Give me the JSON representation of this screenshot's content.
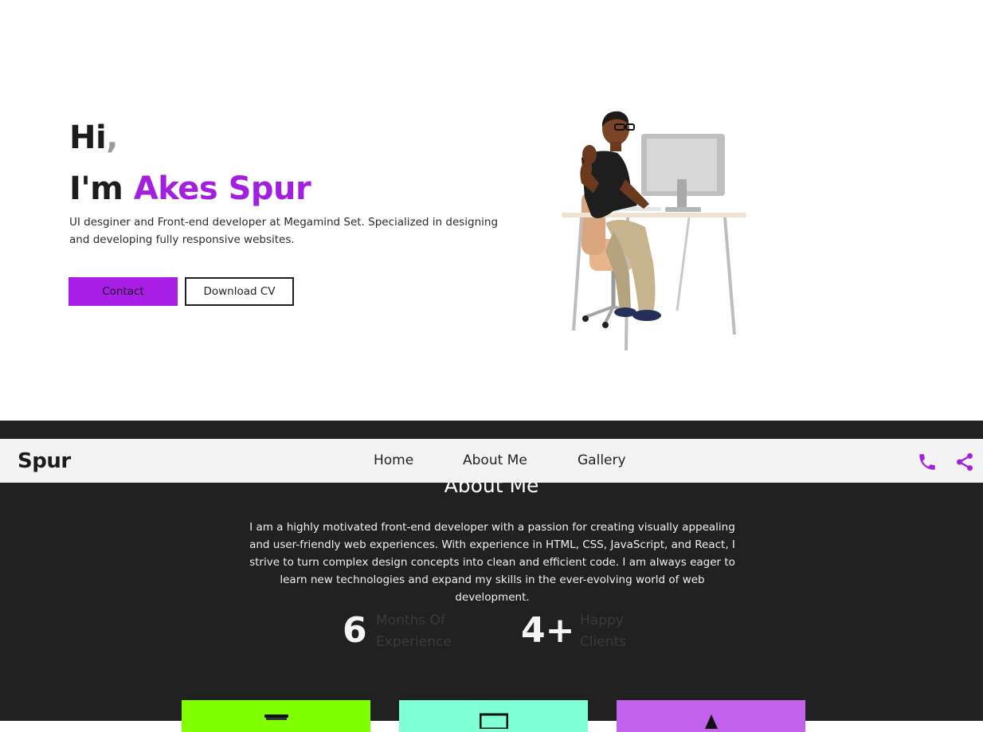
{
  "hero": {
    "greeting": "Hi",
    "greeting_punct": ",",
    "intro_prefix": "I'm ",
    "name": "Akes Spur",
    "bio": "UI desginer and Front-end developer at Megamind Set. Specialized in designing and developing fully responsive websites.",
    "contact_label": "Contact",
    "download_label": "Download CV",
    "illustration": "person-at-desk-illustration"
  },
  "navbar": {
    "brand": "Spur",
    "items": [
      {
        "label": "Home"
      },
      {
        "label": "About Me"
      },
      {
        "label": "Gallery"
      }
    ],
    "icons": [
      "phone-icon",
      "share-icon"
    ]
  },
  "about": {
    "title": "About Me",
    "text": "I am a highly motivated front-end developer with a passion for creating visually appealing and user-friendly web experiences. With experience in HTML, CSS, JavaScript, and React, I strive to turn complex design concepts into clean and efficient code. I am always eager to learn new technologies and expand my skills in the ever-evolving world of web development.",
    "stats": [
      {
        "value": "6",
        "label": "Months Of Experience"
      },
      {
        "value": "4+",
        "label": "Happy Clients"
      }
    ]
  },
  "cards": [
    {
      "color": "#7fff00",
      "icon": "code-icon"
    },
    {
      "color": "#7fffd4",
      "icon": "monitor-icon"
    },
    {
      "color": "#c261ec",
      "icon": "design-icon"
    }
  ],
  "colors": {
    "accent": "#a91ee6",
    "name": "#a120df",
    "dark_bg": "#212121",
    "navbar_bg": "#f3f3f3"
  }
}
